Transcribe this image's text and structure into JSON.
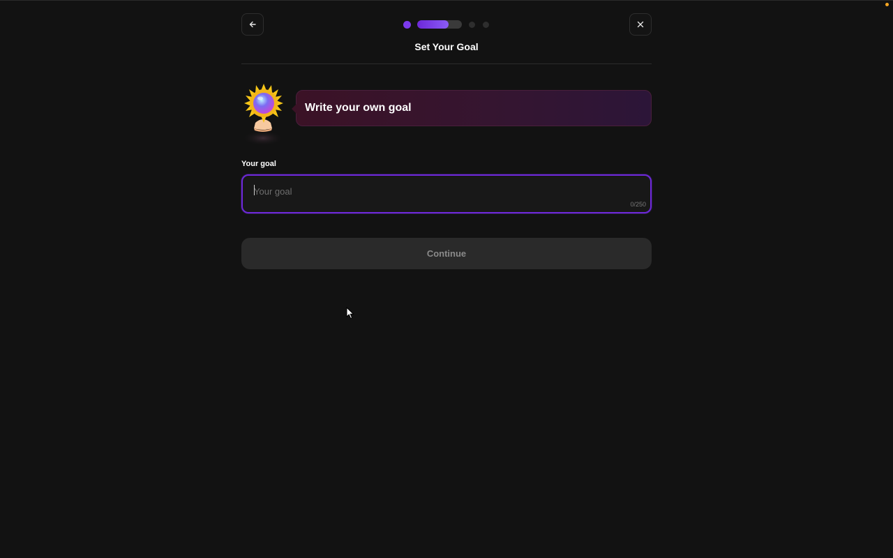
{
  "header": {
    "title": "Set Your Goal",
    "back_icon": "arrow-left-icon",
    "close_icon": "close-icon",
    "progress": {
      "steps_total": 4,
      "current_step": 2,
      "current_step_fill": 0.7
    }
  },
  "prompt": {
    "text": "Write your own goal",
    "mascot_icon": "sun-mascot-icon"
  },
  "goal_field": {
    "label": "Your goal",
    "placeholder": "Your goal",
    "value": "",
    "counter": "0/250"
  },
  "actions": {
    "continue_label": "Continue",
    "continue_disabled": true
  },
  "colors": {
    "background": "#121212",
    "accent": "#7c3aed",
    "bubble": "#3b1226",
    "button_disabled": "#2a2a2a"
  }
}
